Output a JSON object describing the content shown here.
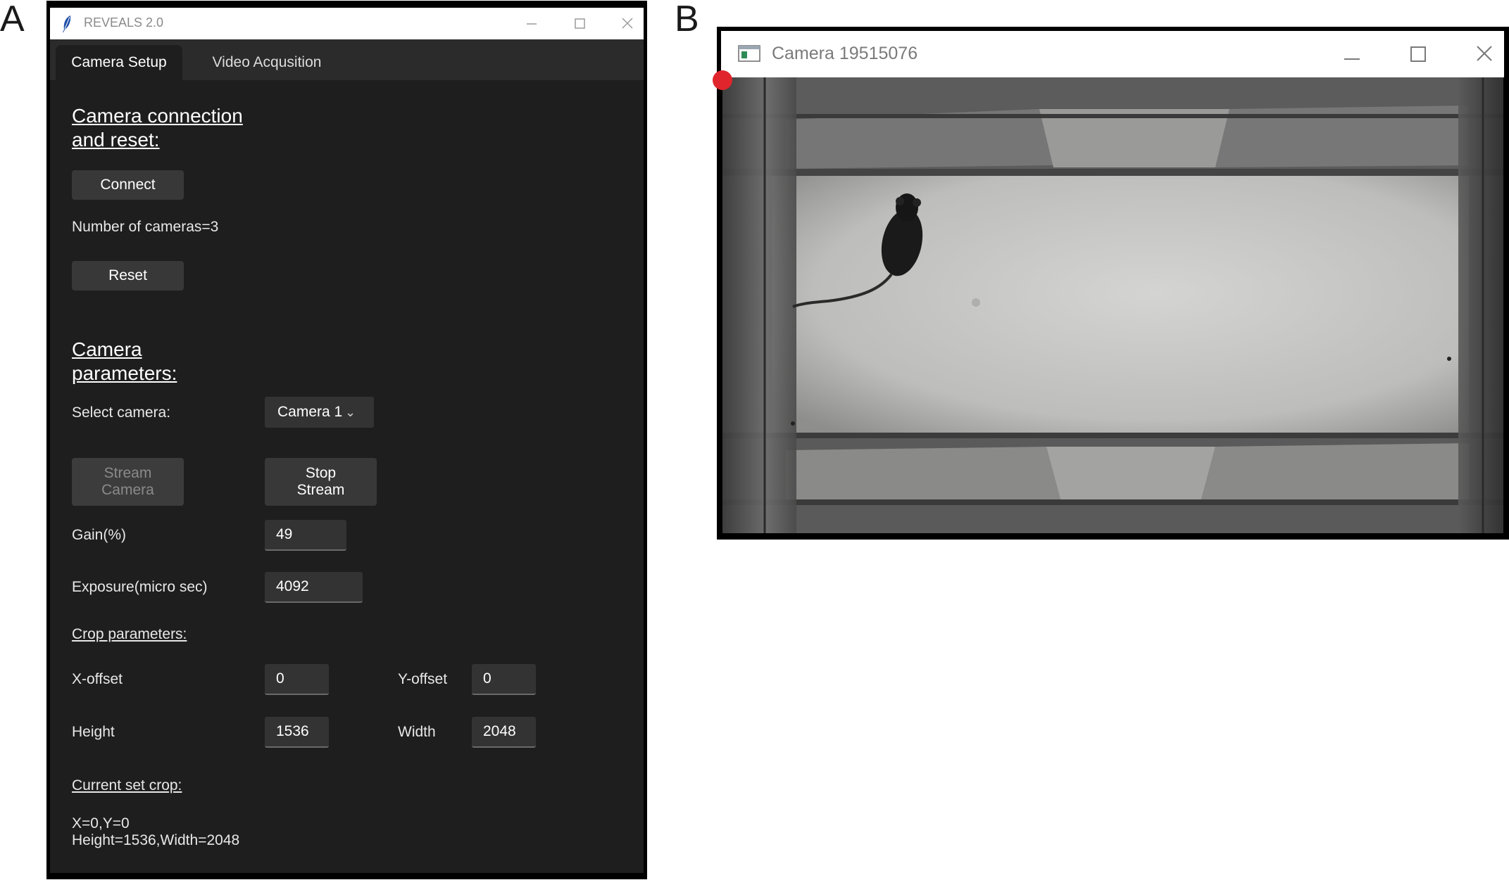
{
  "panel_labels": {
    "a": "A",
    "b": "B"
  },
  "window_a": {
    "title": "REVEALS 2.0",
    "tabs": [
      {
        "label": "Camera Setup",
        "active": true
      },
      {
        "label": "Video Acqusition",
        "active": false
      }
    ],
    "connection": {
      "heading_line1": "Camera connection",
      "heading_line2": "and reset:",
      "connect_label": "Connect",
      "num_cameras_text": "Number of cameras=3",
      "reset_label": "Reset"
    },
    "params": {
      "heading_line1": "Camera",
      "heading_line2": "parameters:",
      "select_camera_label": "Select camera:",
      "select_camera_value": "Camera 1",
      "stream_camera_line1": "Stream",
      "stream_camera_line2": "Camera",
      "stop_stream_line1": "Stop",
      "stop_stream_line2": "Stream",
      "gain_label": "Gain(%)",
      "gain_value": "49",
      "exposure_label": "Exposure(micro sec)",
      "exposure_value": "4092"
    },
    "crop": {
      "heading": "Crop parameters:",
      "x_offset_label": "X-offset",
      "x_offset_value": "0",
      "y_offset_label": "Y-offset",
      "y_offset_value": "0",
      "height_label": "Height",
      "height_value": "1536",
      "width_label": "Width",
      "width_value": "2048",
      "current_heading": "Current set crop:",
      "current_line1": "X=0,Y=0",
      "current_line2": "Height=1536,Width=2048"
    }
  },
  "window_b": {
    "title": "Camera 19515076",
    "recording_indicator_color": "#e0262c"
  },
  "colors": {
    "panel_bg": "#1e1e1e",
    "button_bg": "#383838",
    "entry_bg": "#333333"
  }
}
